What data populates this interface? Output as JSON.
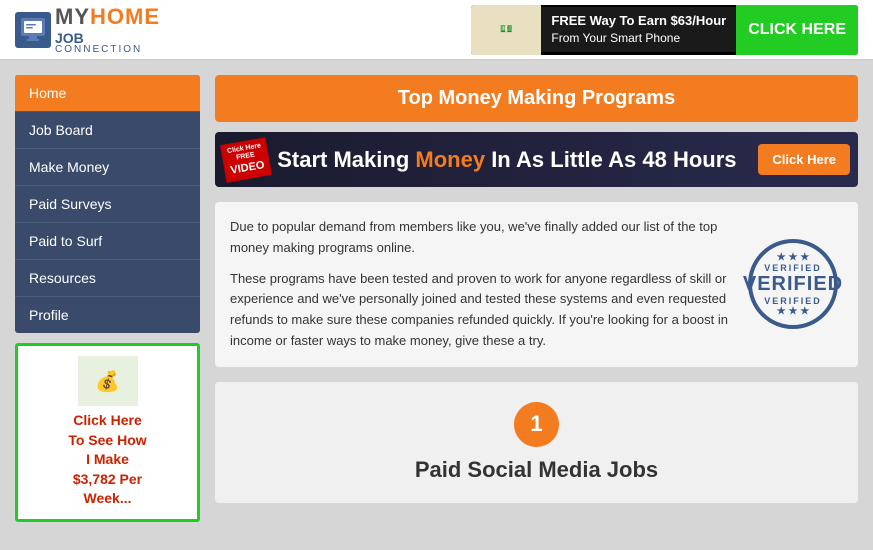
{
  "header": {
    "logo": {
      "my": "MY",
      "home": "HOME",
      "job": "JOB",
      "connection": "CONNECTION"
    },
    "banner": {
      "free_text": "FREE Way To Earn $63/Hour",
      "sub_text": "From Your Smart Phone",
      "click_label": "CLICK HERE"
    }
  },
  "sidebar": {
    "nav_items": [
      {
        "label": "Home",
        "active": true
      },
      {
        "label": "Job Board",
        "active": false
      },
      {
        "label": "Make Money",
        "active": false
      },
      {
        "label": "Paid Surveys",
        "active": false
      },
      {
        "label": "Paid to Surf",
        "active": false
      },
      {
        "label": "Resources",
        "active": false
      },
      {
        "label": "Profile",
        "active": false
      }
    ],
    "promo": {
      "line1": "Click Here",
      "line2": "To See How",
      "line3": "I Make",
      "line4": "$3,782 Per",
      "line5": "Week..."
    }
  },
  "content": {
    "header_title": "Top Money Making Programs",
    "banner": {
      "badge": "VIDEO",
      "text_start": "Start Making ",
      "text_money": "Money",
      "text_end": " In As Little As 48 Hours",
      "btn_label": "Click Here"
    },
    "info": {
      "para1": "Due to popular demand from members like you, we've finally added our list of the top money making programs online.",
      "para2": "These programs have been tested and proven to work for anyone regardless of skill or experience and we've personally joined and tested these systems and even requested refunds to make sure these companies refunded quickly. If you're looking for a boost in income or faster ways to make money, give these a try."
    },
    "stamp": {
      "top": "VERIFIED",
      "main": "VERIFIED",
      "bottom": "VERIFIED"
    },
    "section1": {
      "number": "1",
      "title": "Paid Social Media Jobs"
    }
  }
}
